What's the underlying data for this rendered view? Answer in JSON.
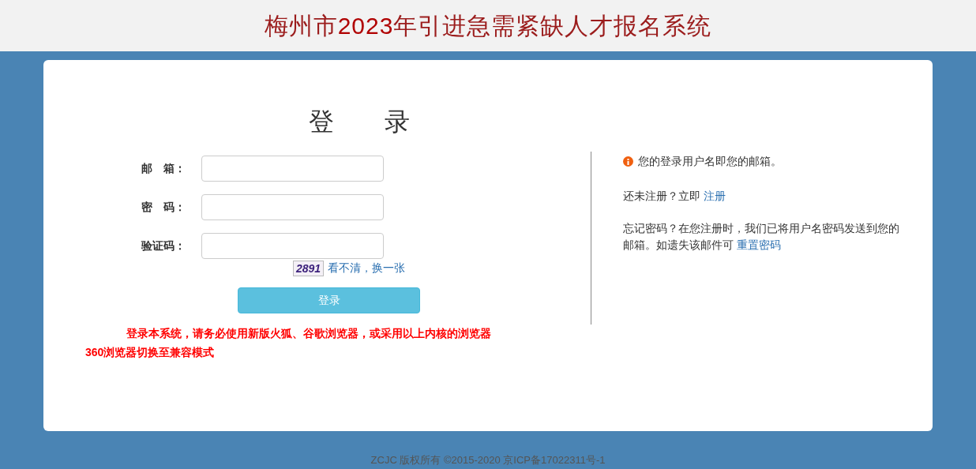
{
  "header": {
    "title_before": "梅州市",
    "title_year": "2023",
    "title_after": "年引进急需紧缺人才报名系统"
  },
  "login": {
    "title": "登　　录",
    "fields": [
      {
        "label": "邮　箱："
      },
      {
        "label": "密　码："
      },
      {
        "label": "验证码："
      }
    ],
    "captcha": {
      "code": "2891",
      "refresh_link": "看不清，换一张"
    },
    "submit": "登录",
    "notices": [
      "登录本系统，请务必使用新版火狐、谷歌浏览器，或采用以上内核的浏览器",
      "360浏览器切换至兼容模式"
    ]
  },
  "info": {
    "hint": "您的登录用户名即您的邮箱。",
    "register_text": "还未注册？立即",
    "register_link": "注册",
    "forgot_text": "忘记密码？在您注册时，我们已将用户名密码发送到您的邮箱。如遗失该邮件可",
    "reset_link": "重置密码"
  },
  "footer": "ZCJC 版权所有 ©2015-2020 京ICP备17022311号-1"
}
